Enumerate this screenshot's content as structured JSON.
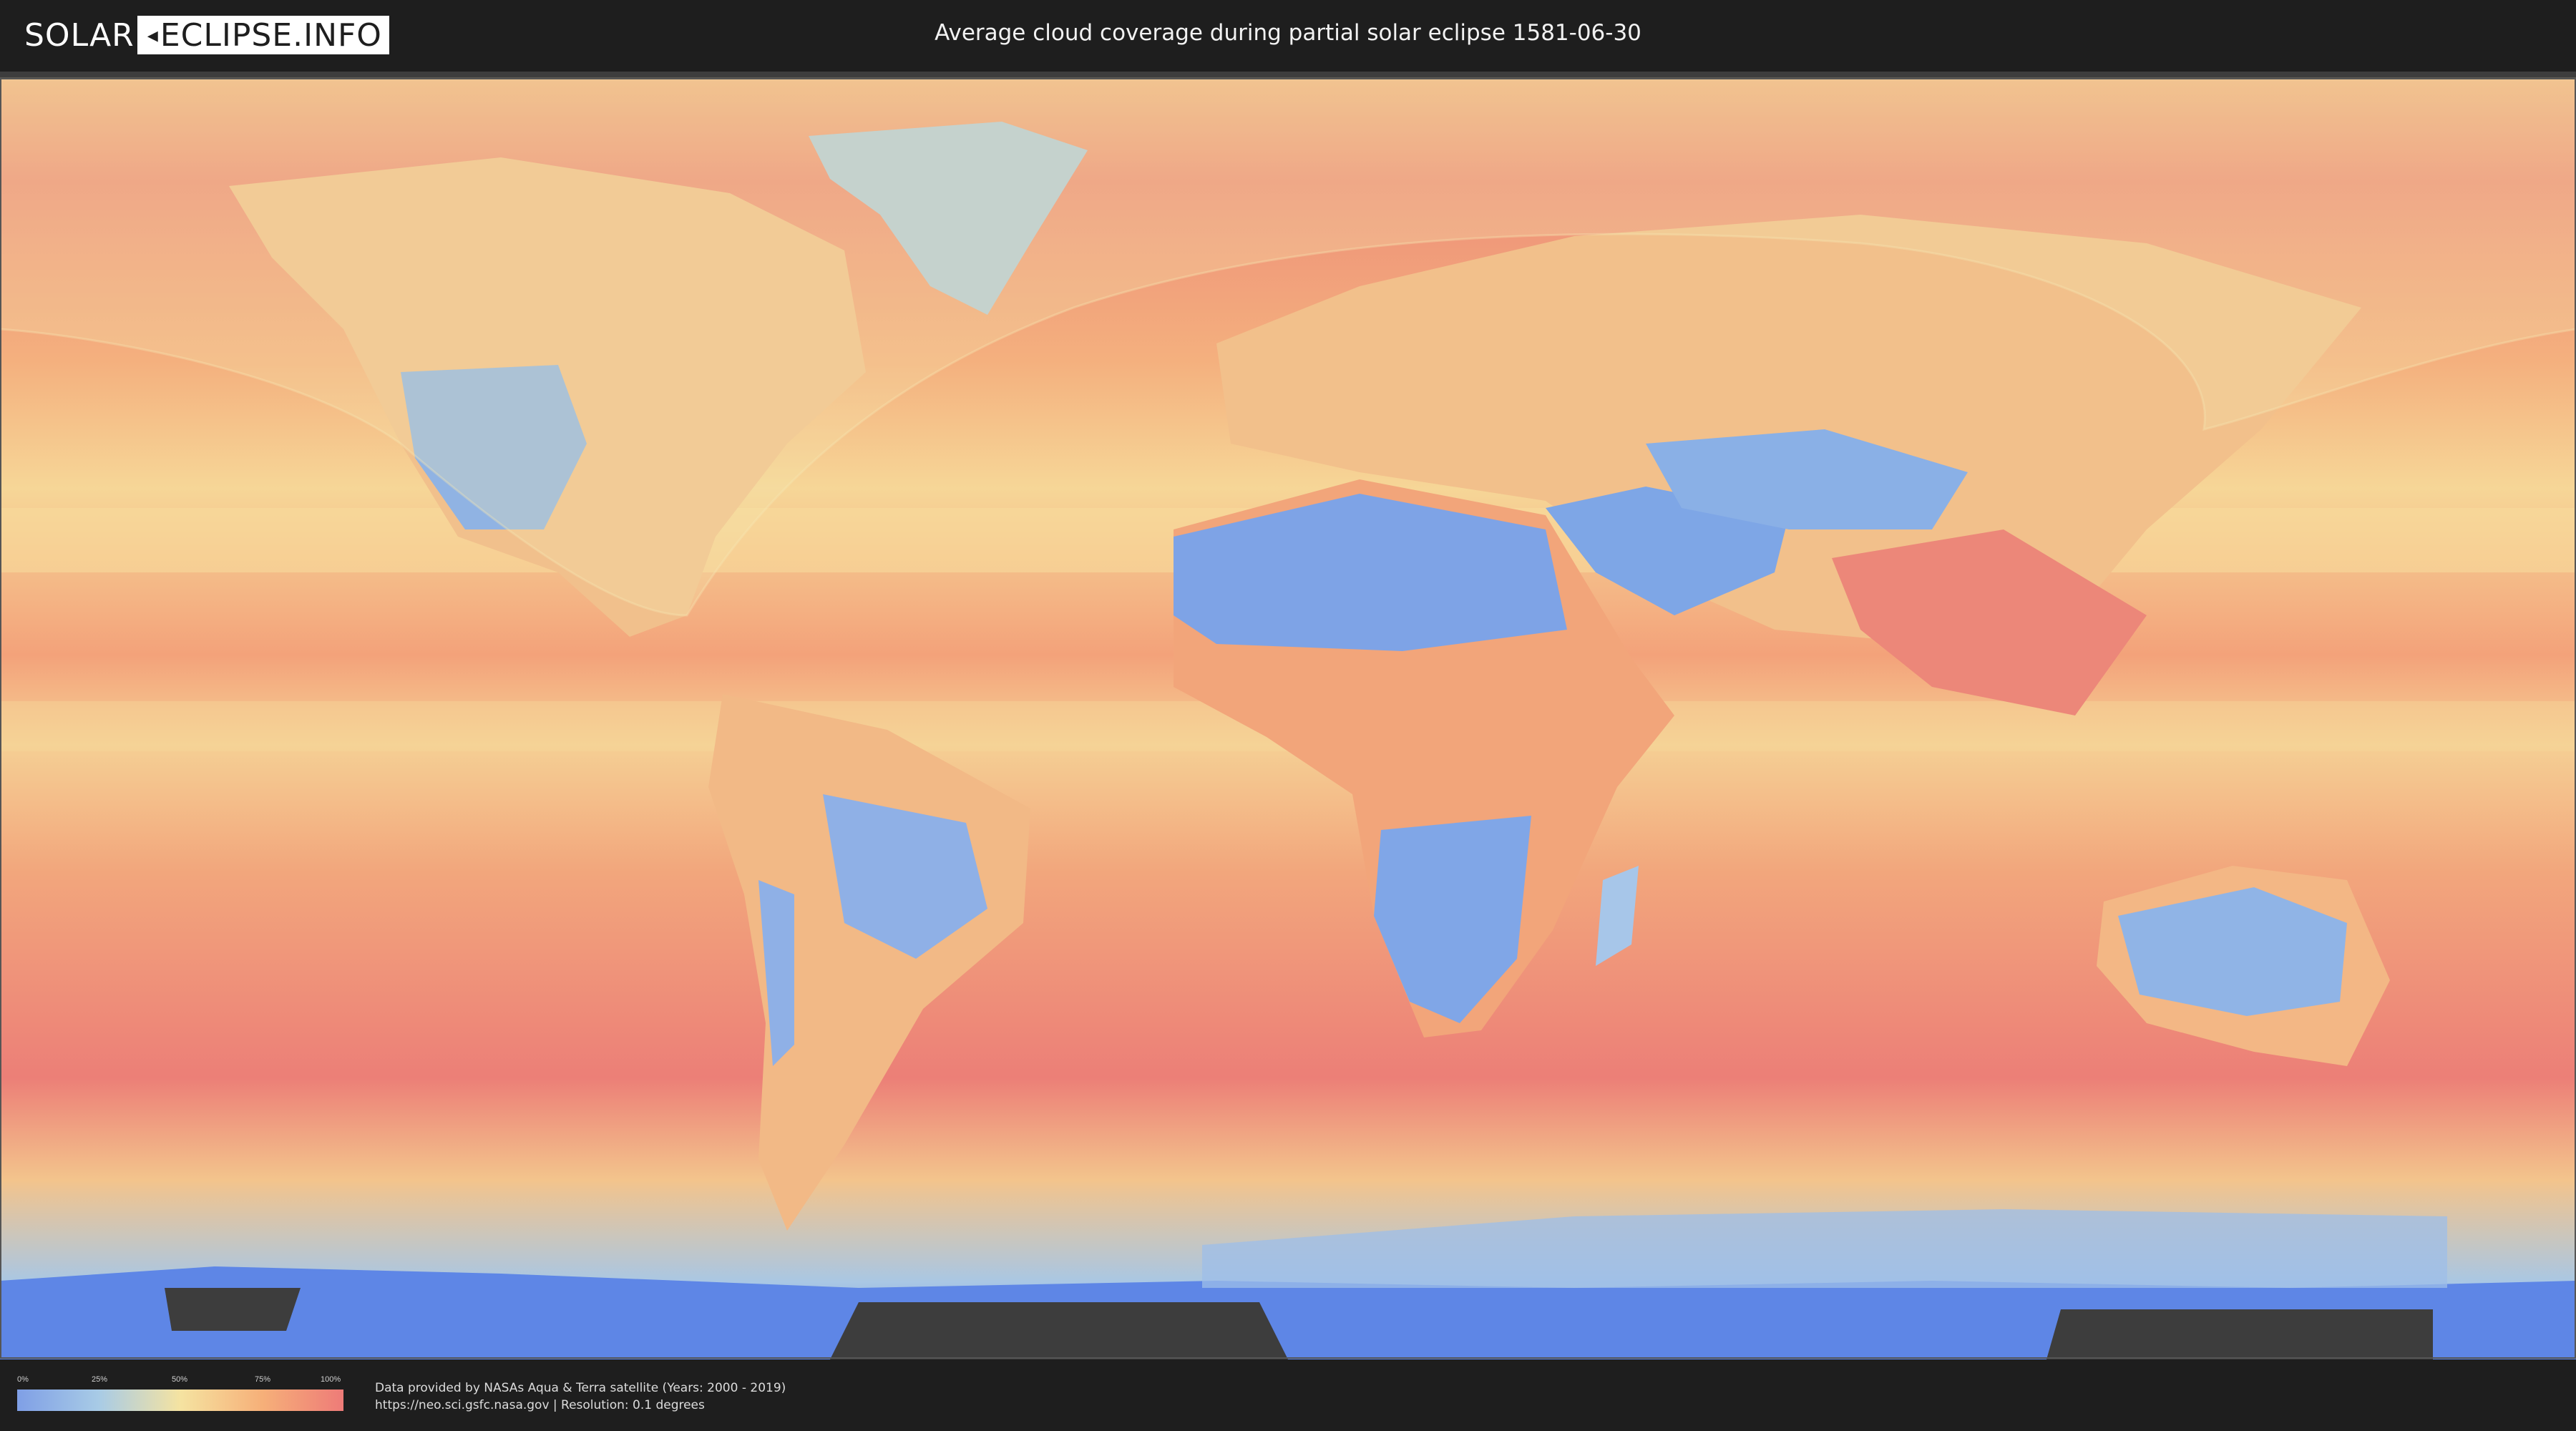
{
  "header": {
    "logo_part1": "SOLAR",
    "logo_part2": "ECLIPSE.INFO",
    "title": "Average cloud coverage during partial solar eclipse 1581-06-30"
  },
  "legend": {
    "ticks": [
      "0%",
      "25%",
      "50%",
      "75%",
      "100%"
    ],
    "colors": [
      "#7f9fe6",
      "#a8cbe6",
      "#f5e3a1",
      "#f6b079",
      "#ee7b78"
    ]
  },
  "footer": {
    "credit_line1": "Data provided by NASAs Aqua & Terra satellite (Years: 2000 - 2019)",
    "credit_line2": "https://neo.sci.gsfc.nasa.gov | Resolution: 0.1 degrees"
  },
  "map": {
    "projection": "equirectangular",
    "layer": "cloud-coverage",
    "eclipse_visibility_overlay": "partial-eclipse-zone",
    "ocean_color": "#ee8a74",
    "land_clear_color": "#7fa6e2"
  }
}
